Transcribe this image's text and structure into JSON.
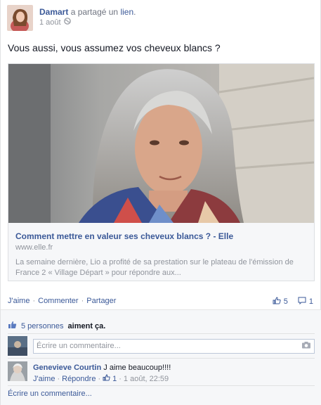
{
  "post": {
    "author": "Damart",
    "action_prefix": "a partagé un",
    "action_link": "lien",
    "action_suffix": ".",
    "date": "1 août",
    "audience_icon": "globe-icon",
    "status_text": "Vous aussi, vous assumez vos cheveux blancs ?"
  },
  "link_card": {
    "title": "Comment mettre en valeur ses cheveux blancs ? - Elle",
    "domain": "www.elle.fr",
    "description": "La semaine dernière, Lio a profité de sa prestation sur le plateau de l'émission de France 2 « Village Départ » pour répondre aux..."
  },
  "actions": {
    "like": "J'aime",
    "comment": "Commenter",
    "share": "Partager",
    "sep": "·",
    "like_count": "5",
    "comment_count": "1"
  },
  "likes_summary": {
    "people": "5 personnes",
    "suffix": "aiment ça."
  },
  "composer": {
    "placeholder": "Écrire un commentaire...",
    "camera_icon": "camera-icon"
  },
  "comment": {
    "author": "Genevieve Courtin",
    "text": "J aime beaucoup!!!!",
    "like": "J'aime",
    "reply": "Répondre",
    "like_count": "1",
    "timestamp": "1 août, 22:59",
    "sep": "·"
  },
  "footer": {
    "write_comment": "Écrire un commentaire..."
  },
  "colors": {
    "link": "#3b5998",
    "muted": "#90949c",
    "ufi_bg": "#f6f7f9"
  }
}
